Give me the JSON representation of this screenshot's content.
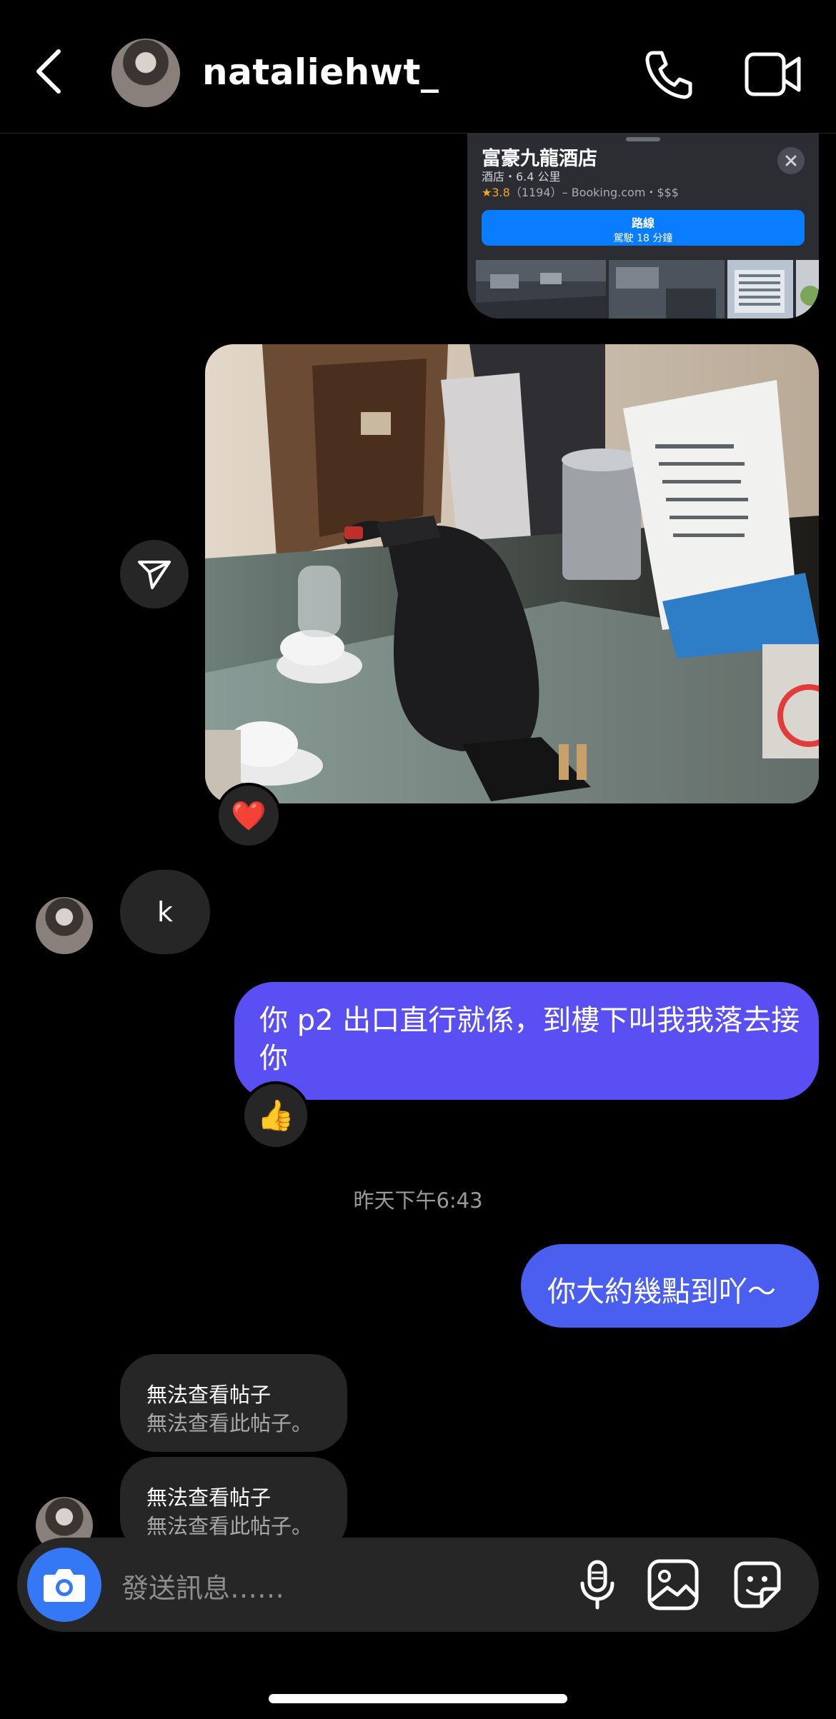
{
  "header": {
    "username": "nataliehwt_",
    "back_icon": "chevron-left-icon",
    "call_icon": "phone-icon",
    "video_icon": "video-camera-icon"
  },
  "location_card": {
    "title": "富豪九龍酒店",
    "subtitle": "酒店・6.4 公里",
    "rating_star": "★",
    "rating": "3.8",
    "rating_detail": "（1194）– Booking.com・$$$",
    "route_label": "路線",
    "route_time": "駕駛 18 分鐘",
    "close_icon": "close-icon",
    "route_color": "#0a7cff"
  },
  "photo_message": {
    "share_icon": "paper-plane-icon",
    "reaction": "❤️"
  },
  "messages": {
    "k_message": "k",
    "sent_1": "你 p2 出口直行就係，到樓下叫我我落去接你",
    "sent_1_reaction": "👍",
    "timestamp": "昨天下午6:43",
    "sent_2": "你大約幾點到吖～",
    "unavailable_posts": [
      {
        "title": "無法查看帖子",
        "subtitle": "無法查看此帖子。"
      },
      {
        "title": "無法查看帖子",
        "subtitle": "無法查看此帖子。"
      }
    ]
  },
  "composer": {
    "placeholder": "發送訊息……",
    "camera_icon": "camera-icon",
    "mic_icon": "microphone-icon",
    "gallery_icon": "image-icon",
    "sticker_icon": "sticker-icon",
    "camera_color": "#3478f6"
  },
  "colors": {
    "sent_bubble": "#5a4ff2",
    "received_bubble": "#262626",
    "background": "#000000"
  }
}
